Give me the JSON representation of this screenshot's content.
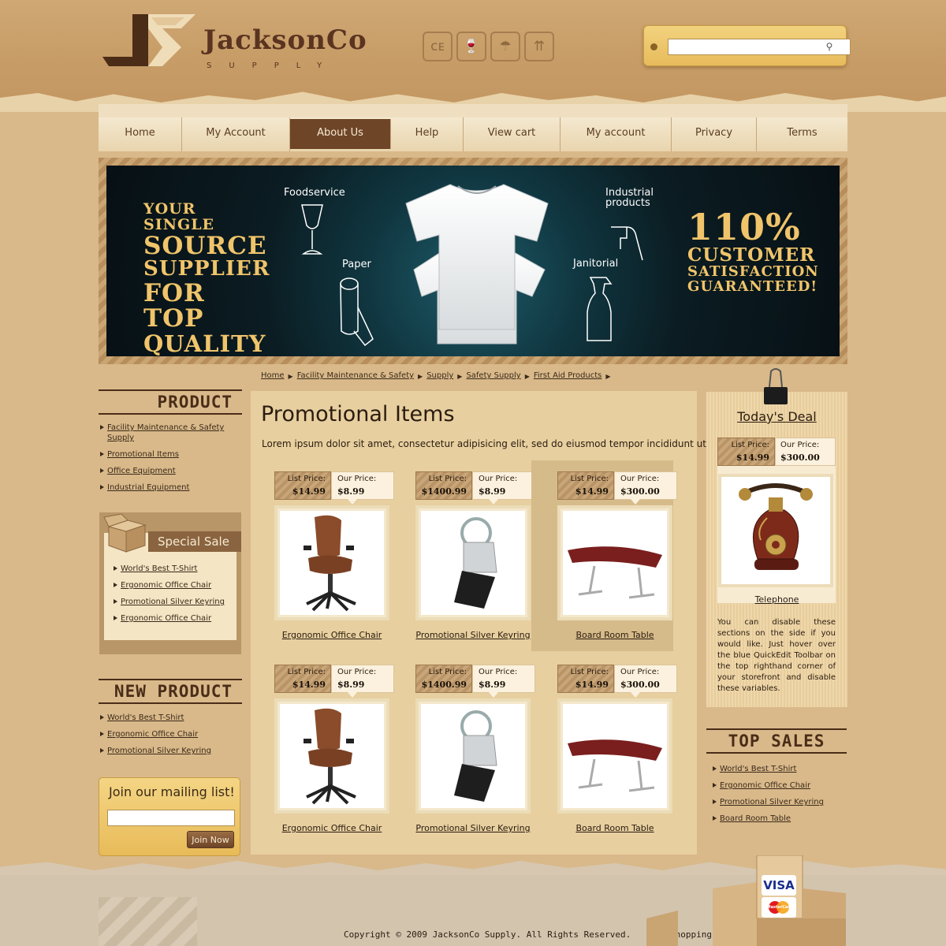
{
  "site": {
    "logo_name": "JacksonCo",
    "logo_sub": "SUPPLY"
  },
  "header": {
    "pack_icons": [
      {
        "name": "ce-mark-icon",
        "glyph": "ᴄᴇ"
      },
      {
        "name": "fragile-icon",
        "glyph": "🍷"
      },
      {
        "name": "keep-dry-icon",
        "glyph": "☂"
      },
      {
        "name": "this-side-up-icon",
        "glyph": "⇈"
      }
    ],
    "search": {
      "value": "",
      "placeholder": ""
    }
  },
  "nav": {
    "items": [
      {
        "label": "Home",
        "width": 106
      },
      {
        "label": "My Account",
        "width": 137
      },
      {
        "label": "About Us",
        "width": 128,
        "active": true
      },
      {
        "label": "Help",
        "width": 92
      },
      {
        "label": "View cart",
        "width": 123
      },
      {
        "label": "My account",
        "width": 141
      },
      {
        "label": "Privacy",
        "width": 108
      },
      {
        "label": "Terms",
        "width": 115
      }
    ]
  },
  "banner": {
    "left_slogan": [
      "YOUR SINGLE",
      "SOURCE",
      "SUPPLIER",
      "FOR TOP",
      "QUALITY"
    ],
    "right_slogan": [
      "110%",
      "CUSTOMER",
      "SATISFACTION",
      "GUARANTEED!"
    ],
    "labels": {
      "foodservice": "Foodservice",
      "paper": "Paper",
      "industrial": "Industrial products",
      "janitorial": "Janitorial"
    }
  },
  "breadcrumb": [
    "Home",
    "Facility Maintenance & Safety",
    "Supply",
    "Safety Supply",
    "First Aid Products"
  ],
  "sidebar": {
    "product_heading": "PRODUCT",
    "product_links": [
      "Facility Maintenance & Safety Supply",
      "Promotional Items",
      "Office Equipment",
      "Industrial Equipment"
    ],
    "special_sale_title": "Special Sale",
    "special_sale_links": [
      "World's Best T-Shirt",
      "Ergonomic Office Chair",
      "Promotional Silver Keyring",
      "Ergonomic Office Chair"
    ],
    "new_product_heading": "NEW PRODUCT",
    "new_product_links": [
      "World's Best T-Shirt",
      "Ergonomic Office Chair",
      "Promotional Silver Keyring"
    ],
    "mailing": {
      "title": "Join our mailing list!",
      "button": "Join Now",
      "value": ""
    }
  },
  "main": {
    "title": "Promotional Items",
    "intro": "Lorem ipsum dolor sit amet, consectetur adipisicing elit, sed do eiusmod tempor incididunt ut labore",
    "list_price_label": "List Price:",
    "our_price_label": "Our Price:",
    "products": [
      {
        "name": "Ergonomic Office Chair",
        "list_price": "$14.99",
        "our_price": "$8.99",
        "image": "chair"
      },
      {
        "name": "Promotional Silver Keyring",
        "list_price": "$1400.99",
        "our_price": "$8.99",
        "image": "keyring"
      },
      {
        "name": "Board Room Table",
        "list_price": "$14.99",
        "our_price": "$300.00",
        "image": "table",
        "highlight": true
      },
      {
        "name": "Ergonomic Office Chair",
        "list_price": "$14.99",
        "our_price": "$8.99",
        "image": "chair"
      },
      {
        "name": "Promotional Silver Keyring",
        "list_price": "$1400.99",
        "our_price": "$8.99",
        "image": "keyring"
      },
      {
        "name": "Board Room Table",
        "list_price": "$14.99",
        "our_price": "$300.00",
        "image": "table"
      }
    ]
  },
  "deal": {
    "title": "Today's Deal",
    "list_price_label": "List Price:",
    "list_price": "$14.99",
    "our_price_label": "Our Price:",
    "our_price": "$300.00",
    "product_name": "Telephone",
    "text": "You can disable these sections on the side if you would like. Just hover over the blue QuickEdit Toolbar on the top righthand corner of your storefront and disable these variables."
  },
  "top_sales": {
    "heading": "TOP SALES",
    "links": [
      "World's Best T-Shirt",
      "Ergonomic Office Chair",
      "Promotional Silver Keyring",
      "Board Room Table"
    ]
  },
  "footer": {
    "copyright": "Copyright © 2009 JacksonCo Supply. All Rights Reserved.",
    "powered": "Shopping Cart Powered by Volusion.",
    "cards": [
      "VISA",
      "MasterCard"
    ]
  }
}
